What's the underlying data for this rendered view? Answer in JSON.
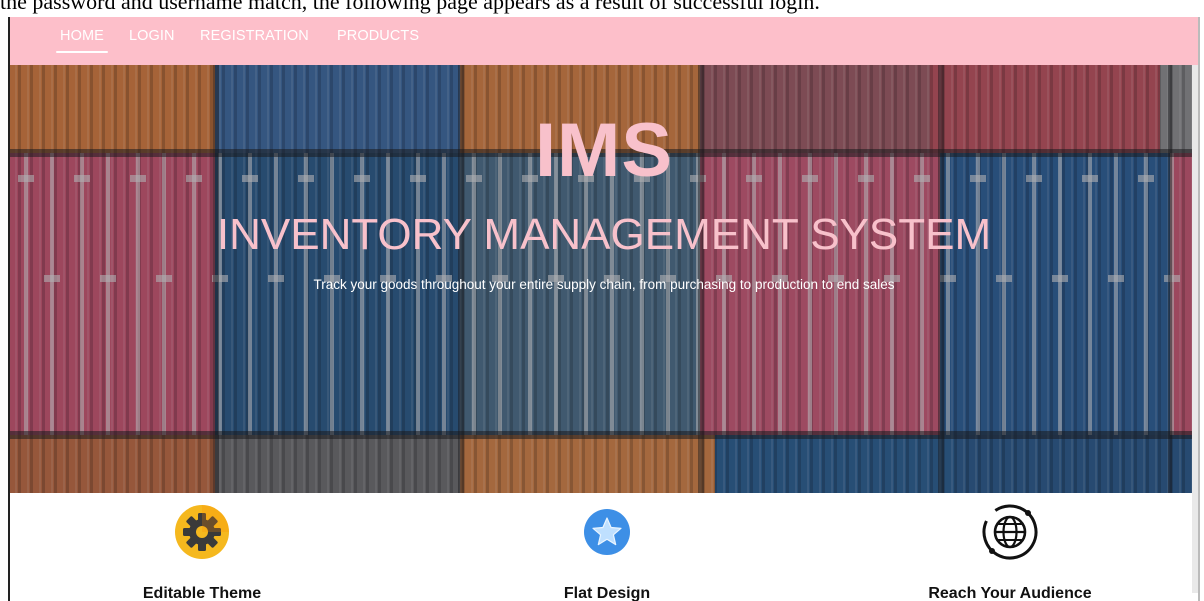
{
  "caption": "the password and username match, the following page appears as a result of successful login.",
  "nav": {
    "items": [
      {
        "label": "HOME",
        "active": true
      },
      {
        "label": "LOGIN",
        "active": false
      },
      {
        "label": "REGISTRATION",
        "active": false
      },
      {
        "label": "PRODUCTS",
        "active": false
      }
    ]
  },
  "hero": {
    "title": "IMS",
    "subtitle": "INVENTORY MANAGEMENT SYSTEM",
    "tagline": "Track your goods throughout your entire supply chain, from purchasing to production to end sales",
    "image": "shipping-containers-photo"
  },
  "features": [
    {
      "label": "Editable Theme",
      "icon": "gear-icon"
    },
    {
      "label": "Flat Design",
      "icon": "star-icon"
    },
    {
      "label": "Reach Your Audience",
      "icon": "globe-icon"
    }
  ],
  "colors": {
    "navbar": "#fdbfca",
    "hero_text": "#f8c1cb",
    "nav_text": "#ffffff"
  }
}
